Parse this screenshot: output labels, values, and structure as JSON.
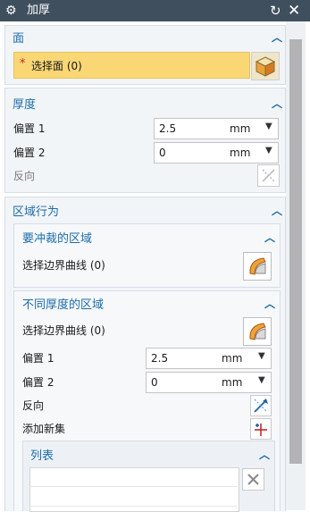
{
  "titlebar": {
    "title": "加厚",
    "gear_icon": "gear-icon",
    "reset_icon": "reset-icon",
    "close_icon": "close-icon"
  },
  "face": {
    "title": "面",
    "required_mark": "*",
    "select_label": "选择面 (0)"
  },
  "thickness": {
    "title": "厚度",
    "offset1": {
      "label": "偏置 1",
      "value": "2.5",
      "unit": "mm"
    },
    "offset2": {
      "label": "偏置 2",
      "value": "0",
      "unit": "mm"
    },
    "reverse_label": "反向"
  },
  "region": {
    "title": "区域行为",
    "trim": {
      "title": "要冲裁的区域",
      "select_label": "选择边界曲线 (0)"
    },
    "diff": {
      "title": "不同厚度的区域",
      "select_label": "选择边界曲线 (0)",
      "offset1": {
        "label": "偏置 1",
        "value": "2.5",
        "unit": "mm"
      },
      "offset2": {
        "label": "偏置 2",
        "value": "0",
        "unit": "mm"
      },
      "reverse_label": "反向",
      "add_set_label": "添加新集",
      "list": {
        "title": "列表"
      }
    }
  },
  "colors": {
    "titlebar_bg": "#3f4f5e",
    "accent": "#1d6ca8",
    "selection_bg": "#f9d775"
  }
}
